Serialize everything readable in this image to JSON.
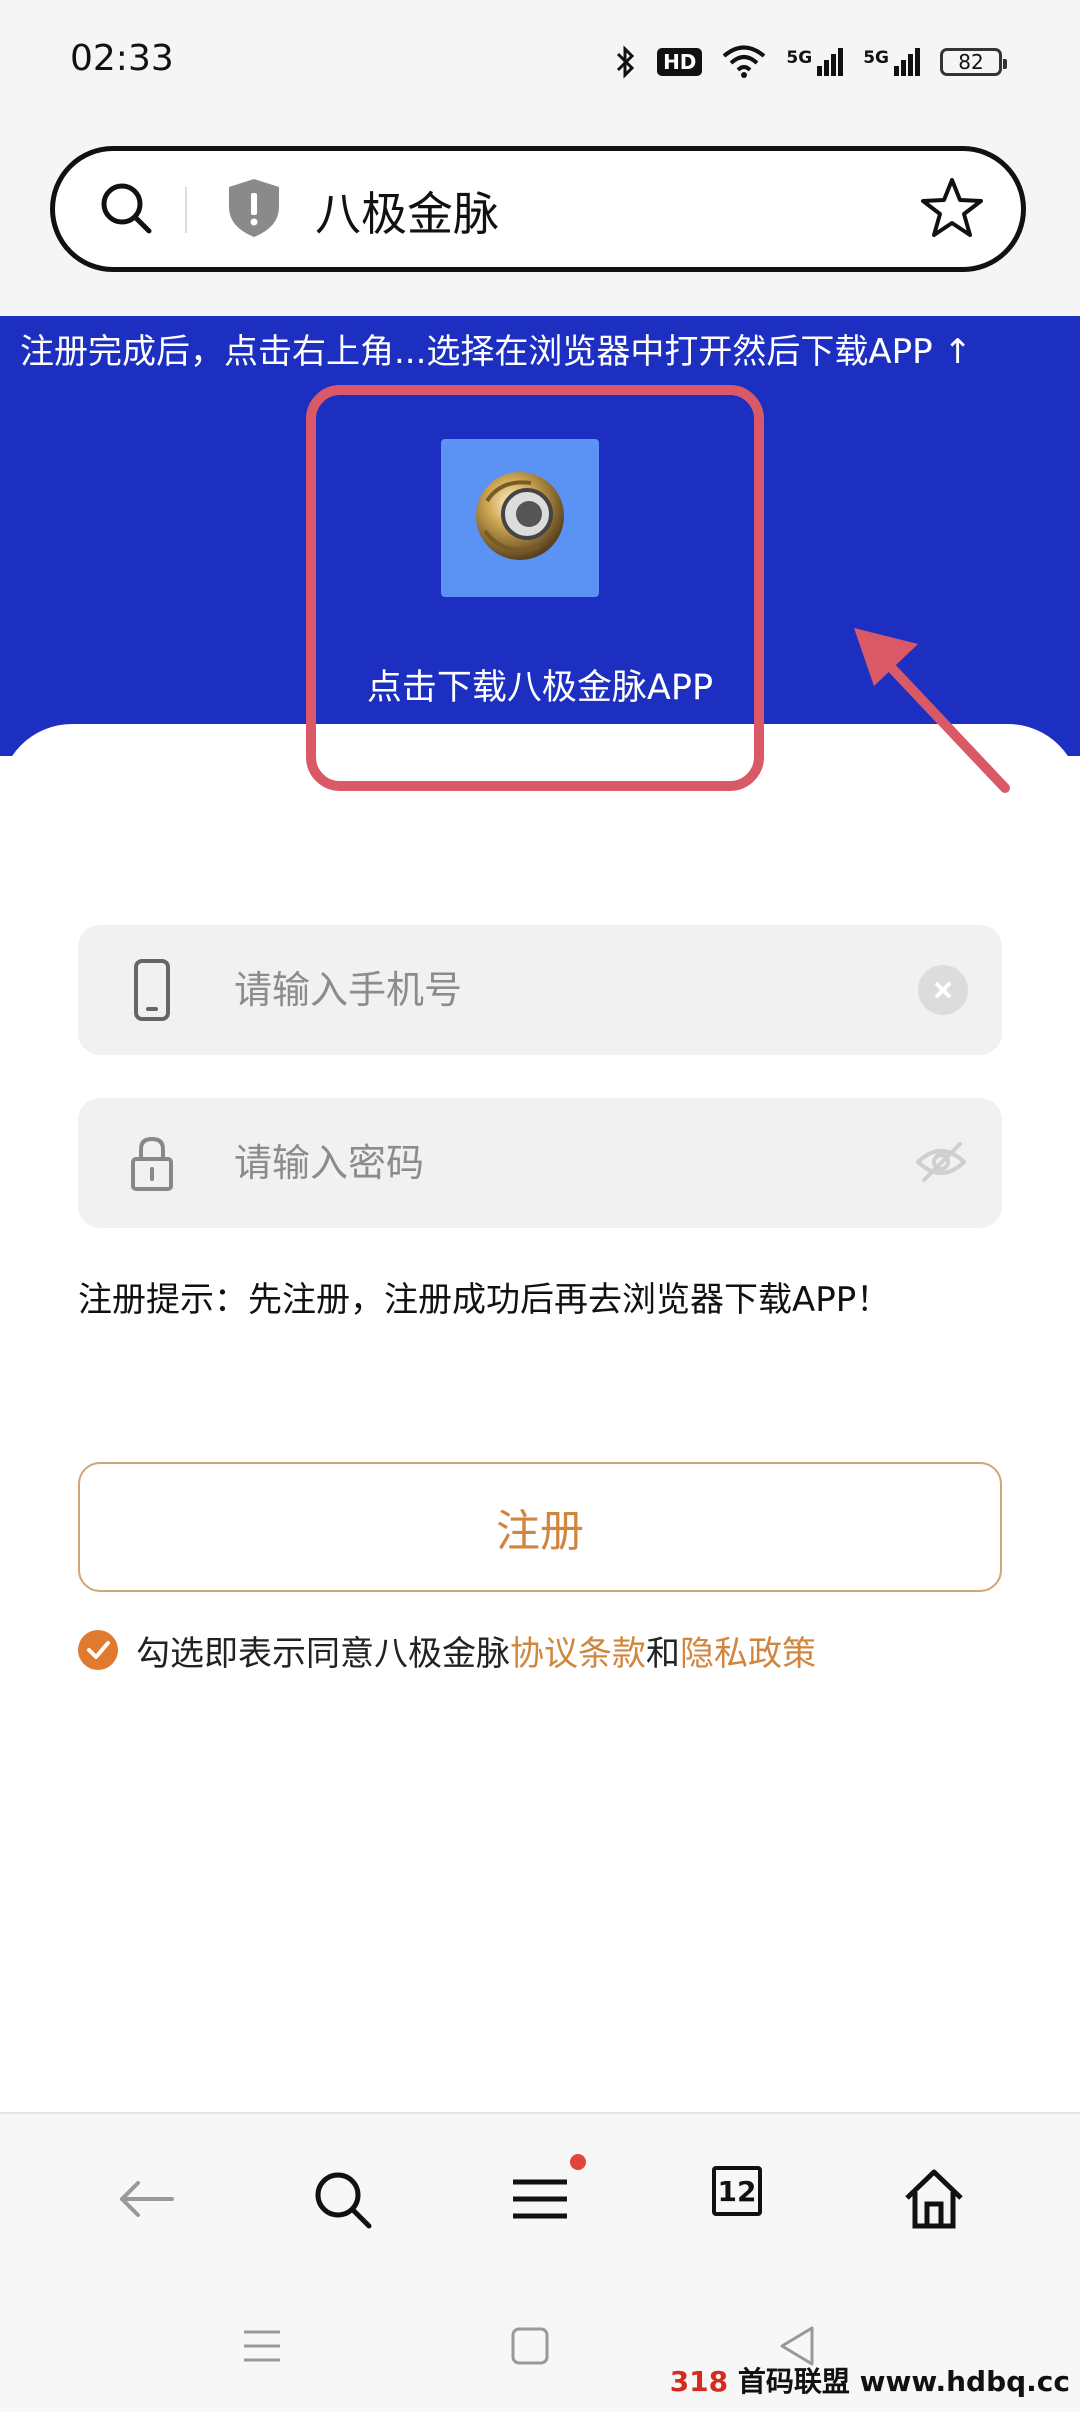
{
  "status_bar": {
    "time": "02:33",
    "hd_label": "HD",
    "signal1_label": "5G",
    "signal2_label": "5G",
    "battery": "82"
  },
  "address_bar": {
    "query": "八极金脉",
    "icons": [
      "search-icon",
      "shield-icon",
      "star-icon"
    ]
  },
  "banner": {
    "tip": "注册完成后，点击右上角...选择在浏览器中打开然后下载APP ↑",
    "download_label": "点击下载八极金脉APP",
    "background": "#1d2fc1"
  },
  "form": {
    "phone_placeholder": "请输入手机号",
    "password_placeholder": "请输入密码",
    "tip": "注册提示：先注册，注册成功后再去浏览器下载APP！",
    "register_label": "注册",
    "agree_prefix": "勾选即表示同意八极金脉",
    "terms_link": "协议条款",
    "and_text": "和",
    "privacy_link": "隐私政策",
    "accent": "#d1863f"
  },
  "bottom_nav": {
    "tabs_count": "12",
    "icons": [
      "back-arrow-icon",
      "search-icon",
      "menu-icon",
      "tabs-icon",
      "home-icon"
    ]
  },
  "watermark": {
    "logo": "318",
    "text": "首码联盟 www.hdbq.cc"
  }
}
